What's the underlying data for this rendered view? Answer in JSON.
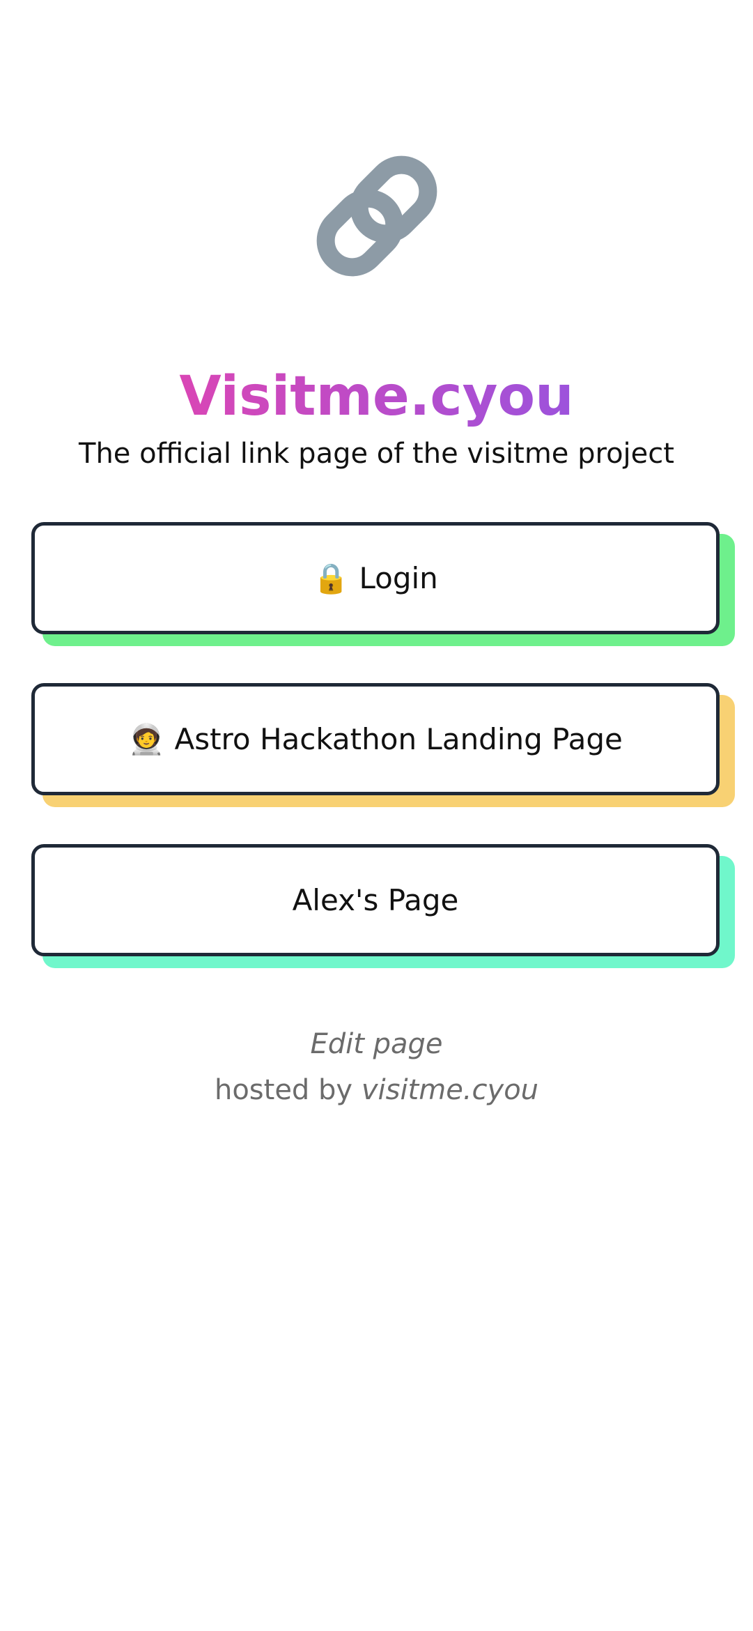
{
  "header": {
    "logo_icon": "link-chain-icon",
    "title": "Visitme.cyou",
    "subtitle": "The official link page of the visitme project",
    "title_gradient": [
      "#d946b5",
      "#9c52dc"
    ]
  },
  "links": [
    {
      "emoji": "🔒",
      "icon": "lock-icon",
      "label": "Login",
      "shadow_color": "#6ef08c"
    },
    {
      "emoji": "🧑‍🚀",
      "icon": "astronaut-icon",
      "label": "Astro Hackathon Landing Page",
      "shadow_color": "#f8d173"
    },
    {
      "emoji": "",
      "icon": "",
      "label": "Alex's Page",
      "shadow_color": "#70f7cb"
    }
  ],
  "footer": {
    "edit_label": "Edit page",
    "hosted_by_prefix": "hosted by",
    "host_name": "visitme.cyou"
  }
}
